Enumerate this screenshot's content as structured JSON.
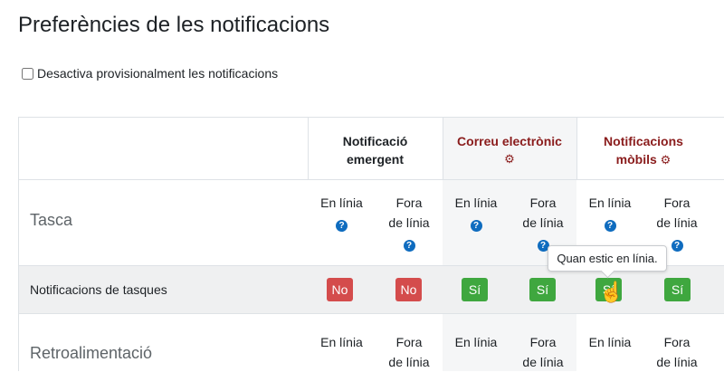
{
  "page": {
    "title": "Preferències de les notificacions",
    "disable_label": "Desactiva provisionalment les notificacions",
    "disable_checked": false
  },
  "columns": {
    "popup": {
      "label_line1": "Notificació",
      "label_line2": "emergent",
      "color": "#1d2125",
      "has_gear": false
    },
    "email": {
      "label_line1": "Correu electrònic",
      "color": "#8a1c1c",
      "has_gear": true,
      "gear_icon": "gear-icon"
    },
    "mobile": {
      "label_line1": "Notificacions",
      "label_line2": "mòbils",
      "color": "#8a1c1c",
      "has_gear": true,
      "gear_icon": "gear-icon"
    }
  },
  "subheaders": {
    "online": "En línia",
    "offline_line1": "Fora",
    "offline_line2": "de línia",
    "help_icon": "question-icon",
    "help_glyph": "?"
  },
  "sections": [
    {
      "label": "Tasca",
      "rows": [
        {
          "label": "Notificacions de tasques",
          "values": {
            "popup_online": "No",
            "popup_offline": "No",
            "email_online": "Sí",
            "email_offline": "Sí",
            "mobile_online": "Sí",
            "mobile_offline": "Sí"
          }
        }
      ]
    },
    {
      "label": "Retroalimentació"
    }
  ],
  "tooltip": {
    "text": "Quan estic en línia."
  },
  "colors": {
    "yes": "#3fa73f",
    "no": "#d44c4c",
    "header_red": "#8a1c1c",
    "help_blue": "#0f6cbf"
  }
}
